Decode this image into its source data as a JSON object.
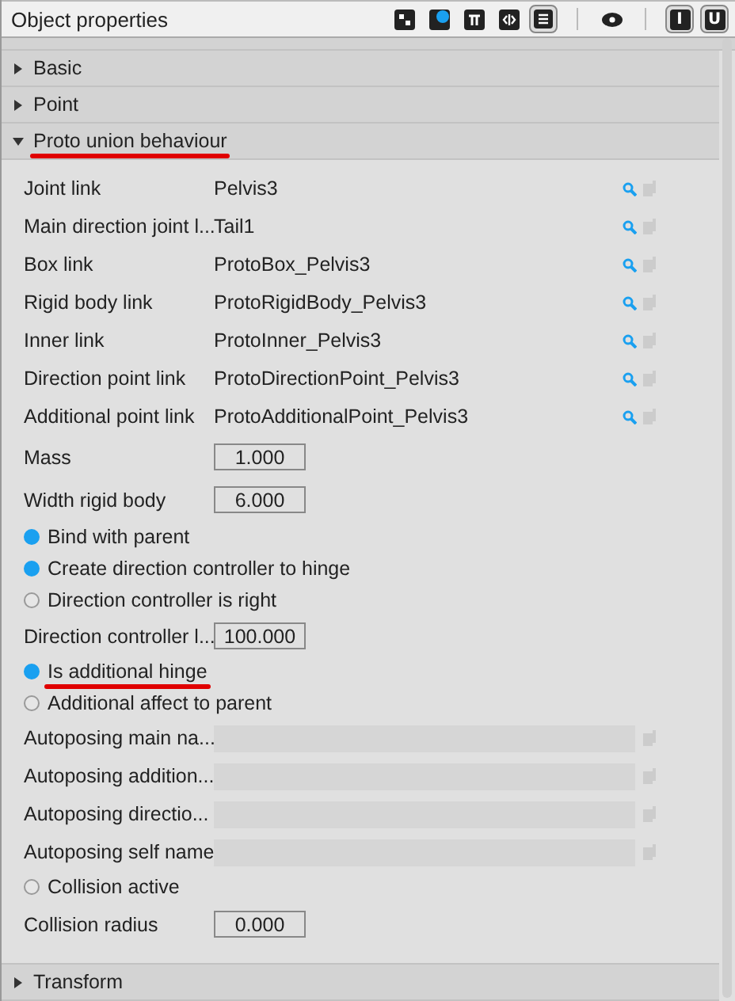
{
  "panel": {
    "title": "Object properties"
  },
  "toolbar": [
    {
      "kind": "puzzle",
      "selected": false
    },
    {
      "kind": "palette",
      "selected": false
    },
    {
      "kind": "pi",
      "selected": false
    },
    {
      "kind": "code",
      "selected": false
    },
    {
      "kind": "list",
      "selected": true
    },
    {
      "kind": "divider"
    },
    {
      "kind": "eye",
      "selected": false
    },
    {
      "kind": "divider"
    },
    {
      "kind": "letter",
      "label": "I",
      "selected": true
    },
    {
      "kind": "letter",
      "label": "U",
      "selected": true
    }
  ],
  "sections_before": [
    {
      "label": "Basic",
      "expanded": false
    },
    {
      "label": "Point",
      "expanded": false
    }
  ],
  "open_section": {
    "label": "Proto union behaviour",
    "expanded": true,
    "underlined": true
  },
  "properties": [
    {
      "kind": "link",
      "label": "Joint link",
      "value": "Pelvis3"
    },
    {
      "kind": "link",
      "label": "Main direction joint l...",
      "value": "Tail1"
    },
    {
      "kind": "link",
      "label": "Box link",
      "value": "ProtoBox_Pelvis3"
    },
    {
      "kind": "link",
      "label": "Rigid body link",
      "value": "ProtoRigidBody_Pelvis3"
    },
    {
      "kind": "link",
      "label": "Inner link",
      "value": "ProtoInner_Pelvis3"
    },
    {
      "kind": "link",
      "label": "Direction point link",
      "value": "ProtoDirectionPoint_Pelvis3"
    },
    {
      "kind": "link",
      "label": "Additional point link",
      "value": "ProtoAdditionalPoint_Pelvis3"
    },
    {
      "kind": "number",
      "label": "Mass",
      "value": "1.000"
    },
    {
      "kind": "number",
      "label": "Width rigid body",
      "value": "6.000"
    },
    {
      "kind": "check",
      "label": "Bind with parent",
      "checked": true,
      "underlined": false
    },
    {
      "kind": "check",
      "label": "Create direction controller to hinge",
      "checked": true,
      "underlined": false
    },
    {
      "kind": "check",
      "label": "Direction controller is right",
      "checked": false,
      "underlined": false
    },
    {
      "kind": "number",
      "label": "Direction controller l...",
      "value": "100.000"
    },
    {
      "kind": "check",
      "label": "Is additional hinge",
      "checked": true,
      "underlined": true
    },
    {
      "kind": "check",
      "label": "Additional affect to parent",
      "checked": false,
      "underlined": false
    },
    {
      "kind": "text",
      "label": "Autoposing main na..."
    },
    {
      "kind": "text",
      "label": "Autoposing addition..."
    },
    {
      "kind": "text",
      "label": "Autoposing directio..."
    },
    {
      "kind": "text",
      "label": "Autoposing self name"
    },
    {
      "kind": "check",
      "label": "Collision active",
      "checked": false,
      "underlined": false
    },
    {
      "kind": "number",
      "label": "Collision radius",
      "value": "0.000"
    }
  ],
  "sections_after": [
    {
      "label": "Transform",
      "expanded": false
    }
  ]
}
